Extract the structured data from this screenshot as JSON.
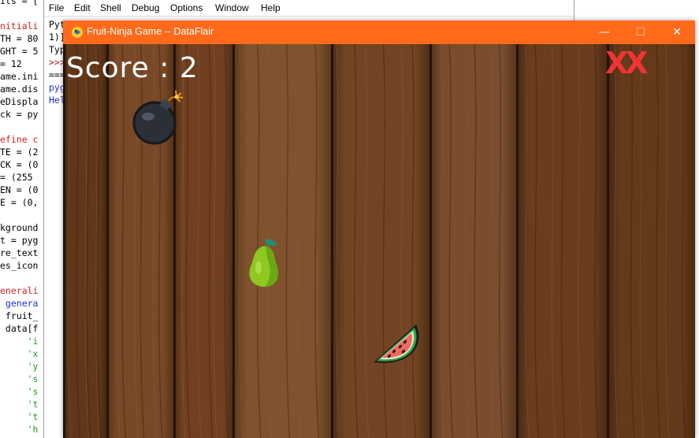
{
  "editor": {
    "lines": [
      {
        "text": "its = [",
        "color": "#000000"
      },
      {
        "text": "",
        "color": "#000000"
      },
      {
        "text": "nitiali",
        "color": "#d42020"
      },
      {
        "text": "TH = 80",
        "color": "#000000"
      },
      {
        "text": "GHT = 5",
        "color": "#000000"
      },
      {
        "text": "= 12",
        "color": "#000000"
      },
      {
        "text": "ame.ini",
        "color": "#000000"
      },
      {
        "text": "ame.dis",
        "color": "#000000"
      },
      {
        "text": "eDispla",
        "color": "#000000"
      },
      {
        "text": "ck = py",
        "color": "#000000"
      },
      {
        "text": "",
        "color": "#000000"
      },
      {
        "text": "efine c",
        "color": "#d42020"
      },
      {
        "text": "TE = (2",
        "color": "#000000"
      },
      {
        "text": "CK = (0",
        "color": "#000000"
      },
      {
        "text": "= (255",
        "color": "#000000"
      },
      {
        "text": "EN = (0",
        "color": "#000000"
      },
      {
        "text": "E = (0,",
        "color": "#000000"
      },
      {
        "text": "",
        "color": "#000000"
      },
      {
        "text": "kground",
        "color": "#000000"
      },
      {
        "text": "t = pyg",
        "color": "#000000"
      },
      {
        "text": "re_text",
        "color": "#000000"
      },
      {
        "text": "es_icon",
        "color": "#000000"
      },
      {
        "text": "",
        "color": "#000000"
      },
      {
        "text": "enerali",
        "color": "#d42020"
      },
      {
        "text": " genera",
        "color": "#1b30d4"
      },
      {
        "text": " fruit_",
        "color": "#000000"
      },
      {
        "text": " data[f",
        "color": "#000000"
      },
      {
        "text": "     'i",
        "color": "#1e9e1e"
      },
      {
        "text": "     'x",
        "color": "#1e9e1e"
      },
      {
        "text": "     'y",
        "color": "#1e9e1e"
      },
      {
        "text": "     's",
        "color": "#1e9e1e"
      },
      {
        "text": "     's",
        "color": "#1e9e1e"
      },
      {
        "text": "     't",
        "color": "#1e9e1e"
      },
      {
        "text": "     't",
        "color": "#1e9e1e"
      },
      {
        "text": "     'h",
        "color": "#1e9e1e"
      }
    ]
  },
  "shell": {
    "menu": [
      "File",
      "Edit",
      "Shell",
      "Debug",
      "Options",
      "Window",
      "Help"
    ],
    "lines": [
      {
        "text": "Pyt",
        "color": "#000000"
      },
      {
        "text": "1)]",
        "color": "#000000"
      },
      {
        "text": "Typ",
        "color": "#000000"
      },
      {
        "text": ">>>",
        "color": "#a02020"
      },
      {
        "text": "===",
        "color": "#000000"
      },
      {
        "text": "pyg",
        "color": "#1b30d4"
      },
      {
        "text": "Hel",
        "color": "#1b30d4"
      }
    ]
  },
  "window": {
    "title": "Fruit-Ninja Game -- DataFlair",
    "minimize_glyph": "—",
    "maximize_glyph": "☐",
    "close_glyph": "✕",
    "titlebar_color": "#ff6a1a"
  },
  "game": {
    "score_label": "Score : 2",
    "lives_marks": "XX",
    "lives_color": "#f03434",
    "sprites": [
      "bomb-icon",
      "guava-icon",
      "watermelon-slice-icon"
    ]
  }
}
